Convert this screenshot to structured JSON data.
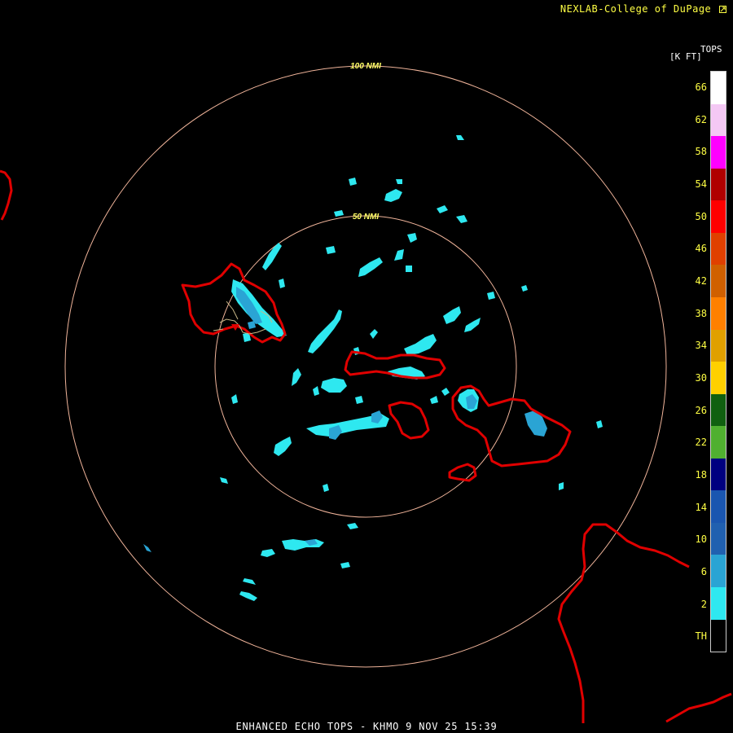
{
  "credit": "NEXLAB-College of DuPage",
  "credit_icon": "corner-arrow-icon",
  "footer": "ENHANCED ECHO TOPS - KHMO 9 NOV 25 15:39",
  "rings": [
    {
      "label": "100 NMI"
    },
    {
      "label": "50 NMI"
    }
  ],
  "legend": {
    "title": "TOPS",
    "units": "[K FT]",
    "levels": [
      {
        "label": "66",
        "color": "#ffffff"
      },
      {
        "label": "62",
        "color": "#f4c8f4"
      },
      {
        "label": "58",
        "color": "#ff00ff"
      },
      {
        "label": "54",
        "color": "#b00000"
      },
      {
        "label": "50",
        "color": "#ff0000"
      },
      {
        "label": "46",
        "color": "#e04000"
      },
      {
        "label": "42",
        "color": "#d06000"
      },
      {
        "label": "38",
        "color": "#ff8000"
      },
      {
        "label": "34",
        "color": "#e0a000"
      },
      {
        "label": "30",
        "color": "#ffd000"
      },
      {
        "label": "26",
        "color": "#106010"
      },
      {
        "label": "22",
        "color": "#50b030"
      },
      {
        "label": "18",
        "color": "#000080"
      },
      {
        "label": "14",
        "color": "#1a56b0"
      },
      {
        "label": "10",
        "color": "#2060b0"
      },
      {
        "label": "6",
        "color": "#2aa4d4"
      },
      {
        "label": "2",
        "color": "#2ee8f0"
      },
      {
        "label": "TH",
        "color": "#000000"
      }
    ]
  },
  "colors": {
    "background": "#000000",
    "range_ring": "#f0b49a",
    "coastline": "#e00000",
    "echo_low": "#2ee8f0",
    "echo_mid": "#2aa4d4"
  }
}
